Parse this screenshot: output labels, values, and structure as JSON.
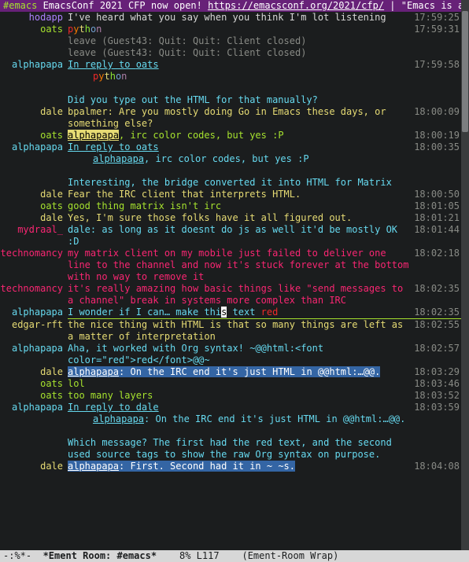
{
  "topic": {
    "channel": "#emacs",
    "text_before_link": " EmacsConf 2021 CFP now open! ",
    "link": "https://emacsconf.org/2021/cfp/",
    "text_after_link": " | \"Emacs is a co"
  },
  "modeline": {
    "left": "-:%*-",
    "buffer": "*Ement Room: #emacs*",
    "position": "8%",
    "line": "L117",
    "mode": "(Ement-Room Wrap)"
  },
  "scrollbar": {
    "thumb_top_pct": 2,
    "thumb_height_pct": 22
  },
  "rainbow_word": [
    "p",
    "y",
    "t",
    "h",
    "o",
    "n"
  ],
  "lines": [
    {
      "nick": "hodapp",
      "cls": "n-purple",
      "ts": "17:59:25",
      "frag": [
        {
          "t": "I've heard what you say when you think I'm lot listening"
        }
      ]
    },
    {
      "nick": "oats",
      "cls": "n-green",
      "ts": "17:59:31",
      "frag": [
        {
          "kind": "rainbow"
        }
      ]
    },
    {
      "nick": "",
      "cls": "",
      "ts": "",
      "frag": [
        {
          "t": "leave (Guest43: Quit: Quit: Client closed)",
          "style": "muted"
        }
      ]
    },
    {
      "nick": "",
      "cls": "",
      "ts": "",
      "frag": [
        {
          "t": "leave (Guest43: Quit: Quit: Client closed)",
          "style": "muted"
        }
      ]
    },
    {
      "nick": "alphapapa",
      "cls": "n-cyan",
      "ts": "17:59:58",
      "frag": [
        {
          "t": "In reply to ",
          "style": "link"
        },
        {
          "t": "oats",
          "style": "link"
        }
      ]
    },
    {
      "nick": "",
      "cls": "",
      "ts": "",
      "frag": [
        {
          "kind": "rainbow"
        }
      ],
      "indent": true
    },
    {
      "kind": "blank"
    },
    {
      "nick": "",
      "cls": "",
      "ts": "",
      "frag": [
        {
          "t": "Did you type out the HTML for that manually?",
          "style": "n-cyan"
        }
      ]
    },
    {
      "nick": "dale",
      "cls": "n-yellow",
      "ts": "18:00:09",
      "frag": [
        {
          "t": "bpalmer: Are you mostly doing Go in Emacs these days, or something else?",
          "style": "mono"
        }
      ]
    },
    {
      "nick": "oats",
      "cls": "n-green",
      "ts": "18:00:19",
      "frag": [
        {
          "t": "alphapapa",
          "style": "pill-y"
        },
        {
          "t": ", irc color codes, but yes :P",
          "style": "n-green"
        }
      ]
    },
    {
      "nick": "alphapapa",
      "cls": "n-cyan",
      "ts": "18:00:35",
      "frag": [
        {
          "t": "In reply to ",
          "style": "link"
        },
        {
          "t": "oats",
          "style": "link"
        }
      ]
    },
    {
      "nick": "",
      "cls": "",
      "ts": "",
      "frag": [
        {
          "t": "alphapapa",
          "style": "link"
        },
        {
          "t": ", irc color codes, but yes :P",
          "style": "n-cyan"
        }
      ],
      "indent": true
    },
    {
      "kind": "blank"
    },
    {
      "nick": "",
      "cls": "",
      "ts": "",
      "frag": [
        {
          "t": "Interesting, the bridge converted it into HTML for Matrix",
          "style": "n-cyan"
        }
      ]
    },
    {
      "nick": "dale",
      "cls": "n-yellow",
      "ts": "18:00:50",
      "frag": [
        {
          "t": "Fear the IRC client that interprets HTML.",
          "style": "mono"
        }
      ]
    },
    {
      "nick": "oats",
      "cls": "n-green",
      "ts": "18:01:05",
      "frag": [
        {
          "t": "good thing matrix isn't irc",
          "style": "n-green"
        }
      ]
    },
    {
      "nick": "dale",
      "cls": "n-yellow",
      "ts": "18:01:21",
      "frag": [
        {
          "t": "Yes, I'm sure those folks have it all figured out.",
          "style": "mono"
        }
      ]
    },
    {
      "nick": "mydraal_",
      "cls": "n-pink",
      "ts": "18:01:44",
      "frag": [
        {
          "t": "dale: as long as it doesnt do js as well it'd be mostly OK :D",
          "style": "n-cyan"
        }
      ]
    },
    {
      "nick": "technomancy",
      "cls": "n-pink",
      "ts": "18:02:18",
      "frag": [
        {
          "t": "my matrix client on my mobile just failed to deliver one line to the channel and now it's stuck forever at the bottom with no way to remove it",
          "style": "n-pink"
        }
      ]
    },
    {
      "nick": "technomancy",
      "cls": "n-pink",
      "ts": "18:02:35",
      "frag": [
        {
          "t": "it's really amazing how basic things like \"send messages to a channel\" break in systems more complex than IRC",
          "style": "n-pink"
        }
      ]
    },
    {
      "nick": "alphapapa",
      "cls": "n-cyan",
      "ts": "18:02:35",
      "frag": [
        {
          "t": "I wonder if I can… make thi",
          "style": "n-cyan"
        },
        {
          "t": "s",
          "style": "cursor"
        },
        {
          "t": " text ",
          "style": "n-cyan"
        },
        {
          "t": "red",
          "style": "red"
        }
      ]
    },
    {
      "kind": "sep"
    },
    {
      "nick": "edgar-rft",
      "cls": "n-yellow",
      "ts": "18:02:55",
      "frag": [
        {
          "t": "the nice thing with HTML is that so many things are left as a matter of interpretation",
          "style": "mono"
        }
      ]
    },
    {
      "nick": "alphapapa",
      "cls": "n-cyan",
      "ts": "18:02:57",
      "frag": [
        {
          "t": "Aha, it worked with Org syntax!  ~@@html:<font color=\"red\">red</font>@@~",
          "style": "n-cyan"
        }
      ]
    },
    {
      "nick": "dale",
      "cls": "n-yellow",
      "ts": "18:03:29",
      "frag": [
        {
          "t": "alphapapa",
          "style": "pill-b-u"
        },
        {
          "t": ": On the IRC end it's just HTML in @@html:…@@.",
          "style": "pill-b"
        }
      ]
    },
    {
      "nick": "oats",
      "cls": "n-green",
      "ts": "18:03:46",
      "frag": [
        {
          "t": "lol",
          "style": "n-green"
        }
      ]
    },
    {
      "nick": "oats",
      "cls": "n-green",
      "ts": "18:03:52",
      "frag": [
        {
          "t": "too many layers",
          "style": "n-green"
        }
      ]
    },
    {
      "nick": "alphapapa",
      "cls": "n-cyan",
      "ts": "18:03:59",
      "frag": [
        {
          "t": "In reply to ",
          "style": "link"
        },
        {
          "t": "dale",
          "style": "link"
        }
      ]
    },
    {
      "nick": "",
      "cls": "",
      "ts": "",
      "frag": [
        {
          "t": "alphapapa",
          "style": "link"
        },
        {
          "t": ": On the IRC end it's just HTML in @@html:…@@.",
          "style": "n-cyan"
        }
      ],
      "indent": true
    },
    {
      "kind": "blank"
    },
    {
      "nick": "",
      "cls": "",
      "ts": "",
      "frag": [
        {
          "t": "Which message? The first had the red text, and the second used source tags to show the raw Org syntax on purpose.",
          "style": "n-cyan"
        }
      ]
    },
    {
      "nick": "dale",
      "cls": "n-yellow",
      "ts": "18:04:08",
      "frag": [
        {
          "t": "alphapapa",
          "style": "pill-b-u"
        },
        {
          "t": ": First. Second had it in ~ ~s.",
          "style": "pill-b"
        }
      ]
    }
  ]
}
